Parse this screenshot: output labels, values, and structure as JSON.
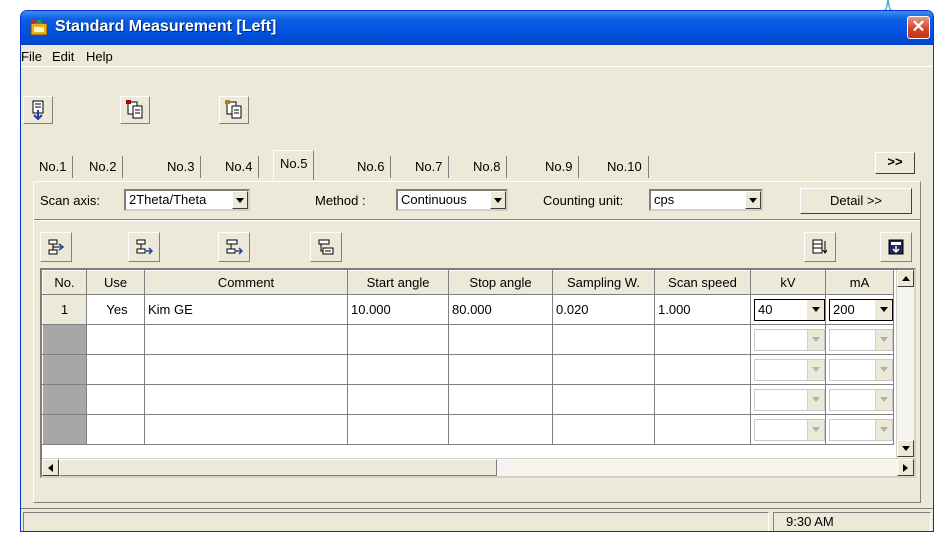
{
  "window": {
    "title": "Standard Measurement [Left]",
    "close_glyph": "✕"
  },
  "menu": [
    "File",
    "Edit",
    "Help"
  ],
  "toolbar": {
    "icons": [
      "measure-icon",
      "copy-condition-icon",
      "paste-condition-icon"
    ]
  },
  "tabs": {
    "items": [
      "No.1",
      "No.2",
      "No.3",
      "No.4",
      "No.5",
      "No.6",
      "No.7",
      "No.8",
      "No.9",
      "No.10"
    ],
    "active": "No.5",
    "more_label": ">>"
  },
  "scan": {
    "axis_label": "Scan axis:",
    "axis_value": "2Theta/Theta",
    "method_label": "Method  :",
    "method_value": "Continuous",
    "unit_label": "Counting unit:",
    "unit_value": "cps",
    "detail_label": "Detail >>"
  },
  "grid_tools": {
    "icons": [
      "insert-row-icon",
      "append-row-icon",
      "copy-row-icon",
      "delete-row-icon",
      "sort-icon",
      "download-icon"
    ]
  },
  "table": {
    "columns": [
      "No.",
      "Use",
      "Comment",
      "Start angle",
      "Stop angle",
      "Sampling W.",
      "Scan speed",
      "kV",
      "mA"
    ],
    "rows": [
      {
        "no": "1",
        "use": "Yes",
        "comment": "Kim GE",
        "start": "10.000",
        "stop": "80.000",
        "sampling": "0.020",
        "speed": "1.000",
        "kv": "40",
        "ma": "200"
      },
      {
        "no": "",
        "use": "",
        "comment": "",
        "start": "",
        "stop": "",
        "sampling": "",
        "speed": "",
        "kv": "",
        "ma": ""
      },
      {
        "no": "",
        "use": "",
        "comment": "",
        "start": "",
        "stop": "",
        "sampling": "",
        "speed": "",
        "kv": "",
        "ma": ""
      },
      {
        "no": "",
        "use": "",
        "comment": "",
        "start": "",
        "stop": "",
        "sampling": "",
        "speed": "",
        "kv": "",
        "ma": ""
      },
      {
        "no": "",
        "use": "",
        "comment": "",
        "start": "",
        "stop": "",
        "sampling": "",
        "speed": "",
        "kv": "",
        "ma": ""
      }
    ]
  },
  "status": {
    "time": "9:30 AM"
  },
  "colors": {
    "titlebar": "#0054e3",
    "face": "#ece9d8",
    "close": "#d5432a",
    "row_header_empty": "#a7a7a7"
  }
}
